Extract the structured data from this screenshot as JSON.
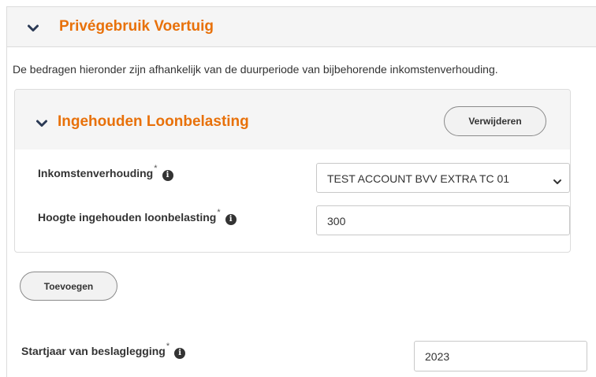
{
  "section": {
    "title": "Privégebruik Voertuig",
    "intro": "De bedragen hieronder zijn afhankelijk van de duurperiode van bijbehorende inkomstenverhouding."
  },
  "withheld_tax": {
    "title": "Ingehouden Loonbelasting",
    "remove_label": "Verwijderen",
    "income_relation": {
      "label": "Inkomstenverhouding",
      "required_mark": "*",
      "value": "TEST ACCOUNT BVV EXTRA TC 01"
    },
    "amount": {
      "label": "Hoogte ingehouden loonbelasting",
      "required_mark": "*",
      "value": "300"
    }
  },
  "add_label": "Toevoegen",
  "start_year": {
    "label": "Startjaar van beslaglegging",
    "required_mark": "*",
    "value": "2023"
  },
  "icons": {
    "chevron": "chevron-down-icon",
    "info": "info-icon",
    "select_caret": "caret-down-icon"
  },
  "colors": {
    "accent": "#e8710a",
    "header_bg": "#f5f5f5",
    "text": "#333333"
  }
}
